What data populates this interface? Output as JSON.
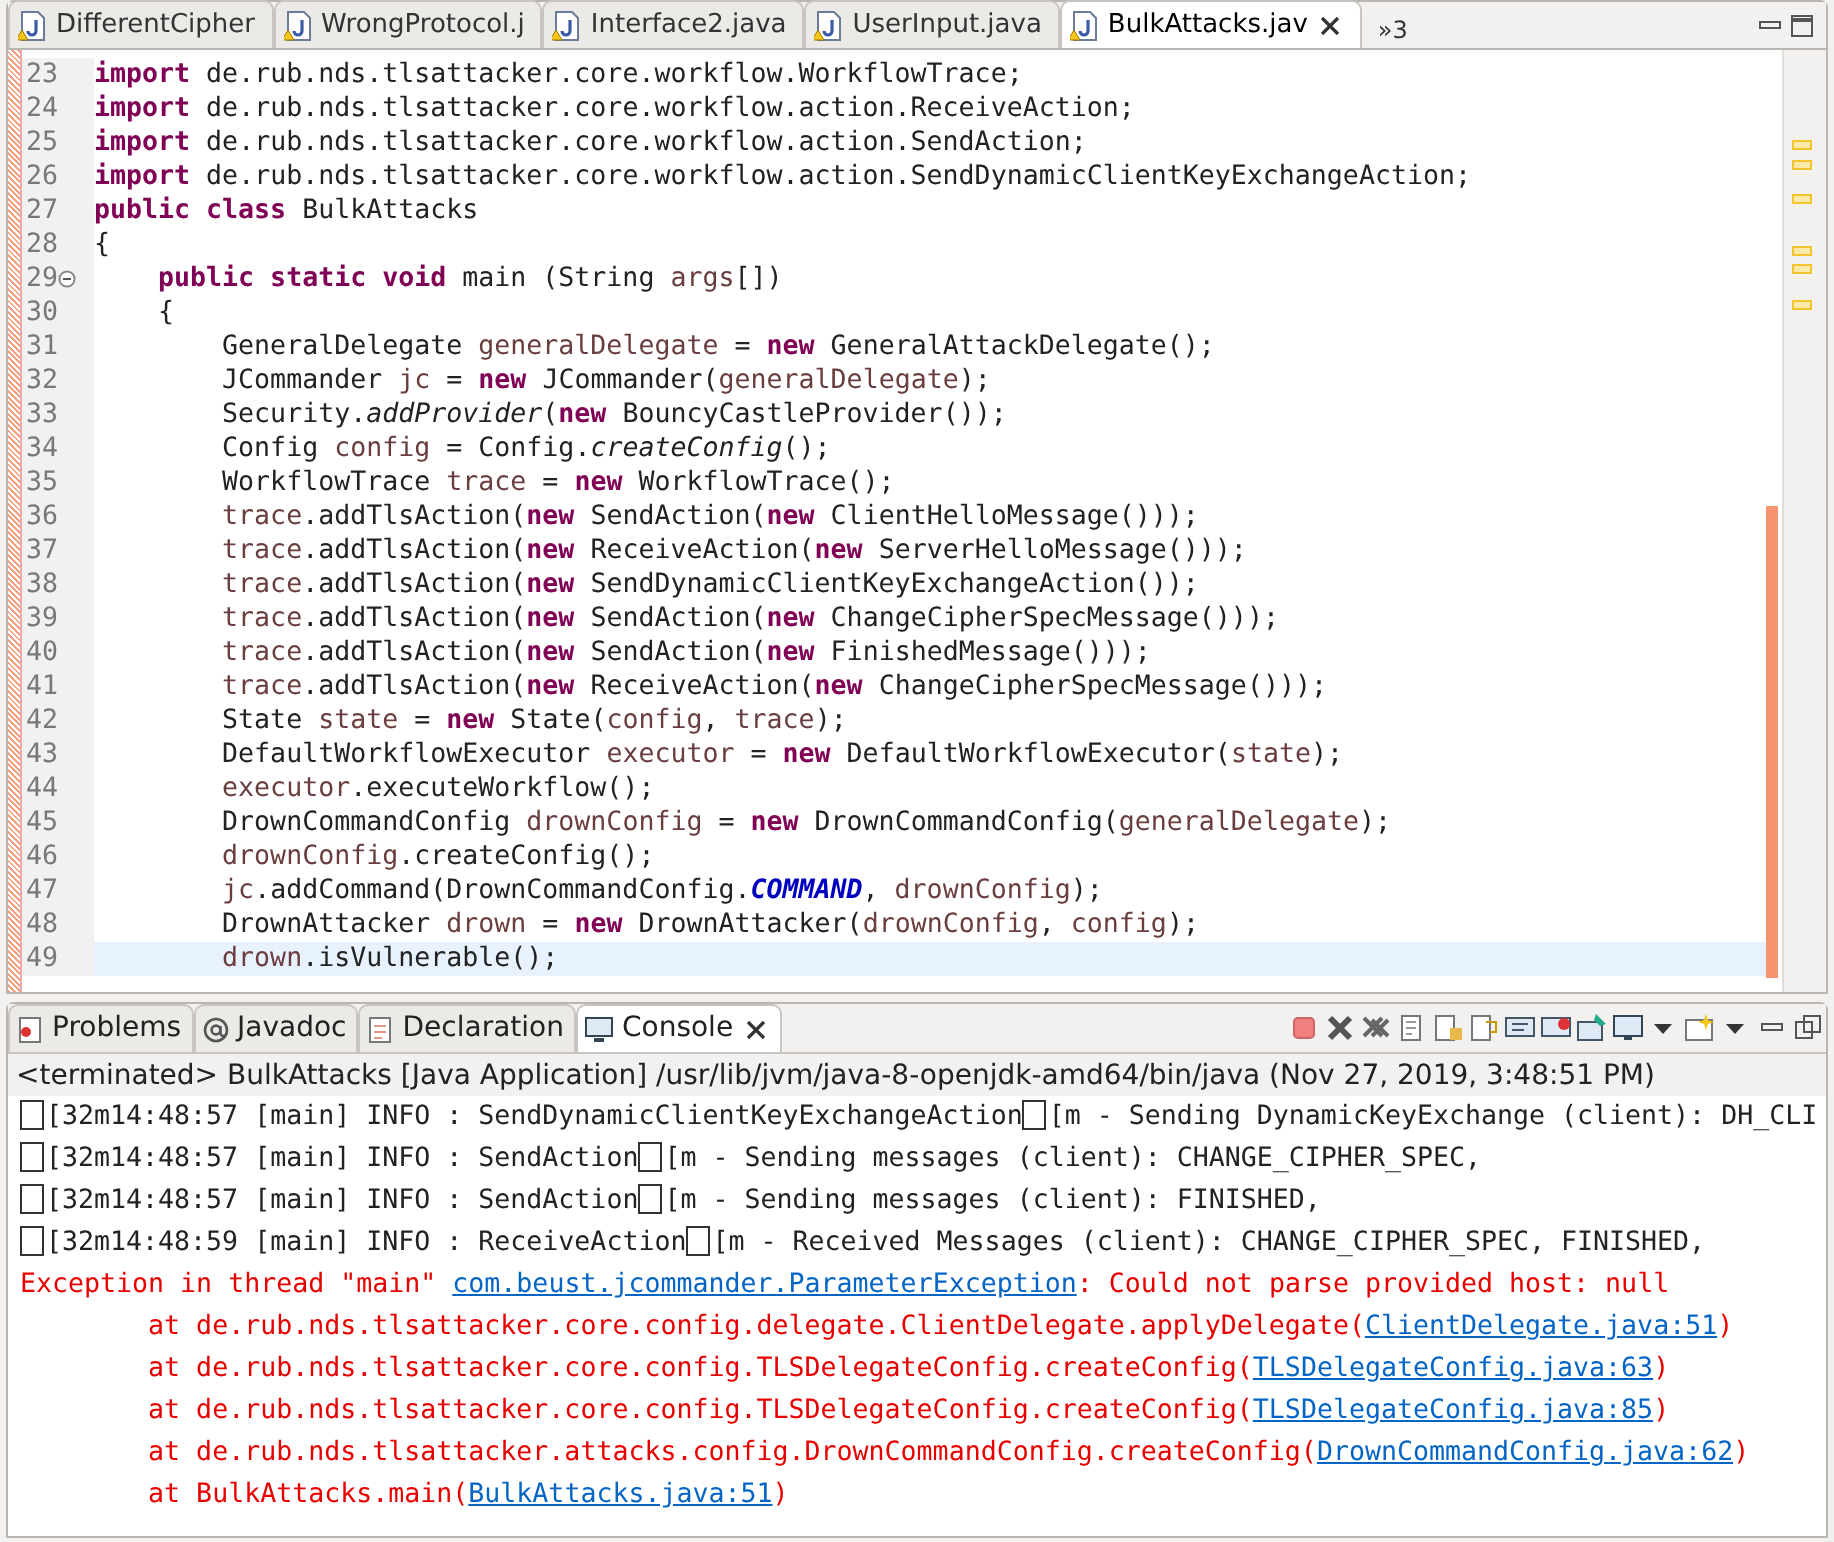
{
  "editor": {
    "tabs": [
      {
        "label": "DifferentCipher",
        "selected": false
      },
      {
        "label": "WrongProtocol.j",
        "selected": false
      },
      {
        "label": "Interface2.java",
        "selected": false
      },
      {
        "label": "UserInput.java",
        "selected": false
      },
      {
        "label": "BulkAttacks.jav",
        "selected": true
      }
    ],
    "overflow": "»3",
    "lines": [
      {
        "num": "23",
        "current": false,
        "folded": false,
        "tokens": [
          {
            "kind": "kw",
            "text": "import"
          },
          {
            "kind": "plain",
            "text": " de.rub.nds.tlsattacker.core.workflow.WorkflowTrace;"
          }
        ]
      },
      {
        "num": "24",
        "current": false,
        "folded": false,
        "tokens": [
          {
            "kind": "kw",
            "text": "import"
          },
          {
            "kind": "plain",
            "text": " de.rub.nds.tlsattacker.core.workflow.action.ReceiveAction;"
          }
        ]
      },
      {
        "num": "25",
        "current": false,
        "folded": false,
        "tokens": [
          {
            "kind": "kw",
            "text": "import"
          },
          {
            "kind": "plain",
            "text": " de.rub.nds.tlsattacker.core.workflow.action.SendAction;"
          }
        ]
      },
      {
        "num": "26",
        "current": false,
        "folded": false,
        "tokens": [
          {
            "kind": "kw",
            "text": "import"
          },
          {
            "kind": "plain",
            "text": " de.rub.nds.tlsattacker.core.workflow.action.SendDynamicClientKeyExchangeAction;"
          }
        ]
      },
      {
        "num": "27",
        "current": false,
        "folded": false,
        "tokens": [
          {
            "kind": "kw",
            "text": "public class"
          },
          {
            "kind": "plain",
            "text": " BulkAttacks"
          }
        ]
      },
      {
        "num": "28",
        "current": false,
        "folded": false,
        "tokens": [
          {
            "kind": "plain",
            "text": "{"
          }
        ]
      },
      {
        "num": "29",
        "current": false,
        "folded": true,
        "tokens": [
          {
            "kind": "kw",
            "text": "    public static void"
          },
          {
            "kind": "plain",
            "text": " main (String "
          },
          {
            "kind": "local",
            "text": "args"
          },
          {
            "kind": "plain",
            "text": "[])"
          }
        ]
      },
      {
        "num": "30",
        "current": false,
        "folded": false,
        "tokens": [
          {
            "kind": "plain",
            "text": "    {"
          }
        ]
      },
      {
        "num": "31",
        "current": false,
        "folded": false,
        "tokens": [
          {
            "kind": "plain",
            "text": "        GeneralDelegate "
          },
          {
            "kind": "local",
            "text": "generalDelegate"
          },
          {
            "kind": "plain",
            "text": " = "
          },
          {
            "kind": "kw",
            "text": "new"
          },
          {
            "kind": "plain",
            "text": " GeneralAttackDelegate();"
          }
        ]
      },
      {
        "num": "32",
        "current": false,
        "folded": false,
        "tokens": [
          {
            "kind": "plain",
            "text": "        JCommander "
          },
          {
            "kind": "local",
            "text": "jc"
          },
          {
            "kind": "plain",
            "text": " = "
          },
          {
            "kind": "kw",
            "text": "new"
          },
          {
            "kind": "plain",
            "text": " JCommander("
          },
          {
            "kind": "local",
            "text": "generalDelegate"
          },
          {
            "kind": "plain",
            "text": ");"
          }
        ]
      },
      {
        "num": "33",
        "current": false,
        "folded": false,
        "tokens": [
          {
            "kind": "plain",
            "text": "        Security."
          },
          {
            "kind": "static",
            "text": "addProvider"
          },
          {
            "kind": "plain",
            "text": "("
          },
          {
            "kind": "kw",
            "text": "new"
          },
          {
            "kind": "plain",
            "text": " BouncyCastleProvider());"
          }
        ]
      },
      {
        "num": "34",
        "current": false,
        "folded": false,
        "tokens": [
          {
            "kind": "plain",
            "text": "        Config "
          },
          {
            "kind": "local",
            "text": "config"
          },
          {
            "kind": "plain",
            "text": " = Config."
          },
          {
            "kind": "static",
            "text": "createConfig"
          },
          {
            "kind": "plain",
            "text": "();"
          }
        ]
      },
      {
        "num": "35",
        "current": false,
        "folded": false,
        "tokens": [
          {
            "kind": "plain",
            "text": "        WorkflowTrace "
          },
          {
            "kind": "local",
            "text": "trace"
          },
          {
            "kind": "plain",
            "text": " = "
          },
          {
            "kind": "kw",
            "text": "new"
          },
          {
            "kind": "plain",
            "text": " WorkflowTrace();"
          }
        ]
      },
      {
        "num": "36",
        "current": false,
        "folded": false,
        "tokens": [
          {
            "kind": "local",
            "text": "        trace"
          },
          {
            "kind": "plain",
            "text": ".addTlsAction("
          },
          {
            "kind": "kw",
            "text": "new"
          },
          {
            "kind": "plain",
            "text": " SendAction("
          },
          {
            "kind": "kw",
            "text": "new"
          },
          {
            "kind": "plain",
            "text": " ClientHelloMessage()));"
          }
        ]
      },
      {
        "num": "37",
        "current": false,
        "folded": false,
        "tokens": [
          {
            "kind": "local",
            "text": "        trace"
          },
          {
            "kind": "plain",
            "text": ".addTlsAction("
          },
          {
            "kind": "kw",
            "text": "new"
          },
          {
            "kind": "plain",
            "text": " ReceiveAction("
          },
          {
            "kind": "kw",
            "text": "new"
          },
          {
            "kind": "plain",
            "text": " ServerHelloMessage()));"
          }
        ]
      },
      {
        "num": "38",
        "current": false,
        "folded": false,
        "tokens": [
          {
            "kind": "local",
            "text": "        trace"
          },
          {
            "kind": "plain",
            "text": ".addTlsAction("
          },
          {
            "kind": "kw",
            "text": "new"
          },
          {
            "kind": "plain",
            "text": " SendDynamicClientKeyExchangeAction());"
          }
        ]
      },
      {
        "num": "39",
        "current": false,
        "folded": false,
        "tokens": [
          {
            "kind": "local",
            "text": "        trace"
          },
          {
            "kind": "plain",
            "text": ".addTlsAction("
          },
          {
            "kind": "kw",
            "text": "new"
          },
          {
            "kind": "plain",
            "text": " SendAction("
          },
          {
            "kind": "kw",
            "text": "new"
          },
          {
            "kind": "plain",
            "text": " ChangeCipherSpecMessage()));"
          }
        ]
      },
      {
        "num": "40",
        "current": false,
        "folded": false,
        "tokens": [
          {
            "kind": "local",
            "text": "        trace"
          },
          {
            "kind": "plain",
            "text": ".addTlsAction("
          },
          {
            "kind": "kw",
            "text": "new"
          },
          {
            "kind": "plain",
            "text": " SendAction("
          },
          {
            "kind": "kw",
            "text": "new"
          },
          {
            "kind": "plain",
            "text": " FinishedMessage()));"
          }
        ]
      },
      {
        "num": "41",
        "current": false,
        "folded": false,
        "tokens": [
          {
            "kind": "local",
            "text": "        trace"
          },
          {
            "kind": "plain",
            "text": ".addTlsAction("
          },
          {
            "kind": "kw",
            "text": "new"
          },
          {
            "kind": "plain",
            "text": " ReceiveAction("
          },
          {
            "kind": "kw",
            "text": "new"
          },
          {
            "kind": "plain",
            "text": " ChangeCipherSpecMessage()));"
          }
        ]
      },
      {
        "num": "42",
        "current": false,
        "folded": false,
        "tokens": [
          {
            "kind": "plain",
            "text": "        State "
          },
          {
            "kind": "local",
            "text": "state"
          },
          {
            "kind": "plain",
            "text": " = "
          },
          {
            "kind": "kw",
            "text": "new"
          },
          {
            "kind": "plain",
            "text": " State("
          },
          {
            "kind": "local",
            "text": "config"
          },
          {
            "kind": "plain",
            "text": ", "
          },
          {
            "kind": "local",
            "text": "trace"
          },
          {
            "kind": "plain",
            "text": ");"
          }
        ]
      },
      {
        "num": "43",
        "current": false,
        "folded": false,
        "tokens": [
          {
            "kind": "plain",
            "text": "        DefaultWorkflowExecutor "
          },
          {
            "kind": "local",
            "text": "executor"
          },
          {
            "kind": "plain",
            "text": " = "
          },
          {
            "kind": "kw",
            "text": "new"
          },
          {
            "kind": "plain",
            "text": " DefaultWorkflowExecutor("
          },
          {
            "kind": "local",
            "text": "state"
          },
          {
            "kind": "plain",
            "text": ");"
          }
        ]
      },
      {
        "num": "44",
        "current": false,
        "folded": false,
        "tokens": [
          {
            "kind": "local",
            "text": "        executor"
          },
          {
            "kind": "plain",
            "text": ".executeWorkflow();"
          }
        ]
      },
      {
        "num": "45",
        "current": false,
        "folded": false,
        "tokens": [
          {
            "kind": "plain",
            "text": "        DrownCommandConfig "
          },
          {
            "kind": "local",
            "text": "drownConfig"
          },
          {
            "kind": "plain",
            "text": " = "
          },
          {
            "kind": "kw",
            "text": "new"
          },
          {
            "kind": "plain",
            "text": " DrownCommandConfig("
          },
          {
            "kind": "local",
            "text": "generalDelegate"
          },
          {
            "kind": "plain",
            "text": ");"
          }
        ]
      },
      {
        "num": "46",
        "current": false,
        "folded": false,
        "tokens": [
          {
            "kind": "local",
            "text": "        drownConfig"
          },
          {
            "kind": "plain",
            "text": ".createConfig();"
          }
        ]
      },
      {
        "num": "47",
        "current": false,
        "folded": false,
        "tokens": [
          {
            "kind": "local",
            "text": "        jc"
          },
          {
            "kind": "plain",
            "text": ".addCommand(DrownCommandConfig."
          },
          {
            "kind": "field",
            "text": "COMMAND"
          },
          {
            "kind": "plain",
            "text": ", "
          },
          {
            "kind": "local",
            "text": "drownConfig"
          },
          {
            "kind": "plain",
            "text": ");"
          }
        ]
      },
      {
        "num": "48",
        "current": false,
        "folded": false,
        "tokens": [
          {
            "kind": "plain",
            "text": "        DrownAttacker "
          },
          {
            "kind": "local",
            "text": "drown"
          },
          {
            "kind": "plain",
            "text": " = "
          },
          {
            "kind": "kw",
            "text": "new"
          },
          {
            "kind": "plain",
            "text": " DrownAttacker("
          },
          {
            "kind": "local",
            "text": "drownConfig"
          },
          {
            "kind": "plain",
            "text": ", "
          },
          {
            "kind": "local",
            "text": "config"
          },
          {
            "kind": "plain",
            "text": ");"
          }
        ]
      },
      {
        "num": "49",
        "current": true,
        "folded": false,
        "tokens": [
          {
            "kind": "local",
            "text": "        drown"
          },
          {
            "kind": "plain",
            "text": ".isVulnerable();"
          }
        ]
      }
    ]
  },
  "bottom_panel": {
    "tabs": [
      {
        "label": "Problems",
        "selected": false
      },
      {
        "label": "Javadoc",
        "selected": false
      },
      {
        "label": "Declaration",
        "selected": false
      },
      {
        "label": "Console",
        "selected": true
      }
    ],
    "status": "<terminated> BulkAttacks [Java Application] /usr/lib/jvm/java-8-openjdk-amd64/bin/java (Nov 27, 2019, 3:48:51 PM)",
    "console": [
      {
        "kind": "out",
        "parts": [
          {
            "kind": "esc"
          },
          {
            "kind": "text",
            "text": "[32m14:48:57 [main] INFO : SendDynamicClientKeyExchangeAction"
          },
          {
            "kind": "esc"
          },
          {
            "kind": "text",
            "text": "[m - Sending DynamicKeyExchange (client): DH_CLI"
          }
        ]
      },
      {
        "kind": "out",
        "parts": [
          {
            "kind": "esc"
          },
          {
            "kind": "text",
            "text": "[32m14:48:57 [main] INFO : SendAction"
          },
          {
            "kind": "esc"
          },
          {
            "kind": "text",
            "text": "[m - Sending messages (client): CHANGE_CIPHER_SPEC,"
          }
        ]
      },
      {
        "kind": "out",
        "parts": [
          {
            "kind": "esc"
          },
          {
            "kind": "text",
            "text": "[32m14:48:57 [main] INFO : SendAction"
          },
          {
            "kind": "esc"
          },
          {
            "kind": "text",
            "text": "[m - Sending messages (client): FINISHED,"
          }
        ]
      },
      {
        "kind": "out",
        "parts": [
          {
            "kind": "esc"
          },
          {
            "kind": "text",
            "text": "[32m14:48:59 [main] INFO : ReceiveAction"
          },
          {
            "kind": "esc"
          },
          {
            "kind": "text",
            "text": "[m - Received Messages (client): CHANGE_CIPHER_SPEC, FINISHED,"
          }
        ]
      },
      {
        "kind": "err",
        "parts": [
          {
            "kind": "text",
            "text": "Exception in thread \"main\" "
          },
          {
            "kind": "link",
            "text": "com.beust.jcommander.ParameterException"
          },
          {
            "kind": "text",
            "text": ": Could not parse provided host: null"
          }
        ]
      },
      {
        "kind": "err",
        "parts": [
          {
            "kind": "text",
            "text": "        at de.rub.nds.tlsattacker.core.config.delegate.ClientDelegate.applyDelegate("
          },
          {
            "kind": "link",
            "text": "ClientDelegate.java:51"
          },
          {
            "kind": "text",
            "text": ")"
          }
        ]
      },
      {
        "kind": "err",
        "parts": [
          {
            "kind": "text",
            "text": "        at de.rub.nds.tlsattacker.core.config.TLSDelegateConfig.createConfig("
          },
          {
            "kind": "link",
            "text": "TLSDelegateConfig.java:63"
          },
          {
            "kind": "text",
            "text": ")"
          }
        ]
      },
      {
        "kind": "err",
        "parts": [
          {
            "kind": "text",
            "text": "        at de.rub.nds.tlsattacker.core.config.TLSDelegateConfig.createConfig("
          },
          {
            "kind": "link",
            "text": "TLSDelegateConfig.java:85"
          },
          {
            "kind": "text",
            "text": ")"
          }
        ]
      },
      {
        "kind": "err",
        "parts": [
          {
            "kind": "text",
            "text": "        at de.rub.nds.tlsattacker.attacks.config.DrownCommandConfig.createConfig("
          },
          {
            "kind": "link",
            "text": "DrownCommandConfig.java:62"
          },
          {
            "kind": "text",
            "text": ")"
          }
        ]
      },
      {
        "kind": "err",
        "parts": [
          {
            "kind": "text",
            "text": "        at BulkAttacks.main("
          },
          {
            "kind": "link",
            "text": "BulkAttacks.java:51"
          },
          {
            "kind": "text",
            "text": ")"
          }
        ]
      }
    ]
  }
}
